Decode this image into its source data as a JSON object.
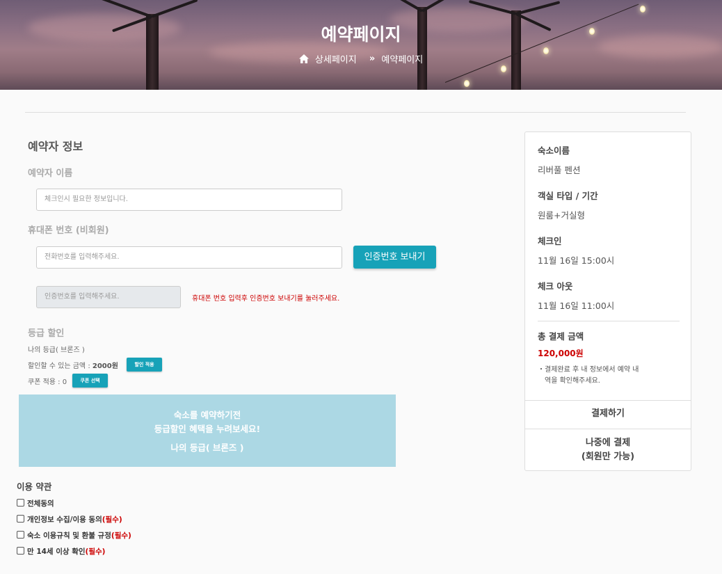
{
  "hero": {
    "title": "예약페이지",
    "breadcrumb": [
      "상세페이지",
      "예약페이지"
    ]
  },
  "form": {
    "section_title": "예약자 정보",
    "name_label": "예약자 이름",
    "name_placeholder": "체크인시 필요한 정보입니다.",
    "phone_label": "휴대폰 번호 (비회원)",
    "phone_placeholder": "전화번호를 입력해주세요.",
    "send_code_button": "인증번호 보내기",
    "code_placeholder": "인증번호를 입력해주세요.",
    "code_hint": "휴대폰 번호 입력후 인증번호 보내기를 눌러주세요."
  },
  "discount": {
    "title": "등급 할인",
    "my_grade": "나의 등급( 브론즈 )",
    "discount_prefix": "할인할 수 있는 금액 : ",
    "discount_amount": "2000원",
    "apply_button": "할인 적용",
    "coupon_text": "쿠폰 적용 : 0",
    "coupon_button": "쿠폰 선택"
  },
  "promo": {
    "line1": "숙소를 예약하기전",
    "line2": "등급할인 혜택을 누려보세요!",
    "line3": "나의 등급( 브론즈 )"
  },
  "terms": {
    "title": "이용 약관",
    "items": [
      {
        "label": "전체동의",
        "required": ""
      },
      {
        "label": "개인정보 수집/이용 동의",
        "required": "(필수)"
      },
      {
        "label": "숙소 이용규칙 및 환불 규정",
        "required": "(필수)"
      },
      {
        "label": "만 14세 이상 확인",
        "required": "(필수)"
      }
    ]
  },
  "summary": {
    "stay_label": "숙소이름",
    "stay_value": "리버풀 펜션",
    "room_label": "객실 타입 / 기간",
    "room_value": "원룸+거실형",
    "checkin_label": "체크인",
    "checkin_value": "11월 16일 15:00시",
    "checkout_label": "체크 아웃",
    "checkout_value": "11월 16일 11:00시",
    "total_label": "총 결제 금액",
    "total_value": "120,000원",
    "note_line1": "・결제완료 후 내 정보에서 예약 내",
    "note_line2": "역을 확인해주세요.",
    "pay_button": "결제하기",
    "later_line1": "나중에 결제",
    "later_line2": "(회원만 가능)"
  },
  "colors": {
    "accent": "#17a2b8",
    "required": "#cc0000",
    "promo_bg": "#acd8e4"
  }
}
